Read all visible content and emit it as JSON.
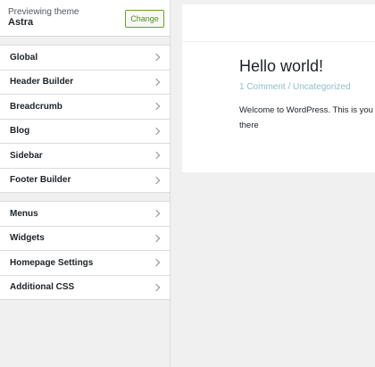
{
  "theme": {
    "preview_label": "Previewing theme",
    "name": "Astra",
    "change_label": "Change"
  },
  "panel_1": [
    {
      "label": "Global"
    },
    {
      "label": "Header Builder"
    },
    {
      "label": "Breadcrumb"
    },
    {
      "label": "Blog"
    },
    {
      "label": "Sidebar"
    },
    {
      "label": "Footer Builder"
    }
  ],
  "panel_2": [
    {
      "label": "Menus"
    },
    {
      "label": "Widgets"
    },
    {
      "label": "Homepage Settings"
    },
    {
      "label": "Additional CSS"
    }
  ],
  "preview": {
    "post_title": "Hello world!",
    "post_meta": "1 Comment / Uncategorized",
    "post_body": "Welcome to WordPress. This is your first post. Edit or delete it, then start writing!",
    "post_body_visible": "Welcome to WordPress. This is you there"
  },
  "colors": {
    "accent_green": "#6aa31a",
    "meta_link": "#8fbfc7"
  }
}
